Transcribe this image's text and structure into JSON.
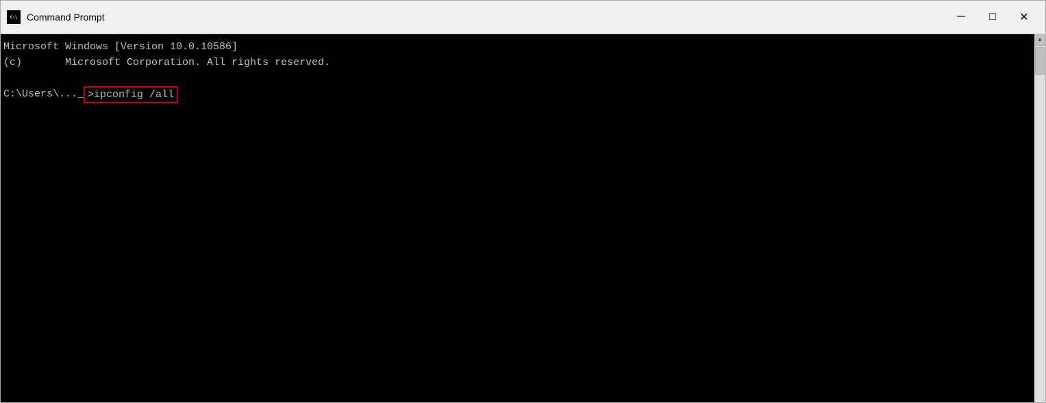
{
  "window": {
    "title": "Command Prompt",
    "icon_label": "cmd-icon"
  },
  "title_bar": {
    "minimize_label": "─",
    "maximize_label": "□",
    "close_label": "✕"
  },
  "console": {
    "line1": "Microsoft Windows [Version 10.0.10586]",
    "line2": "(c)       Microsoft Corporation. All rights reserved.",
    "line3": "",
    "prompt": "C:\\Users\\...",
    "command": ">ipconfig /all",
    "command_display": "ipconfig /all",
    "prompt_prefix": "C:\\Users\\..._"
  }
}
